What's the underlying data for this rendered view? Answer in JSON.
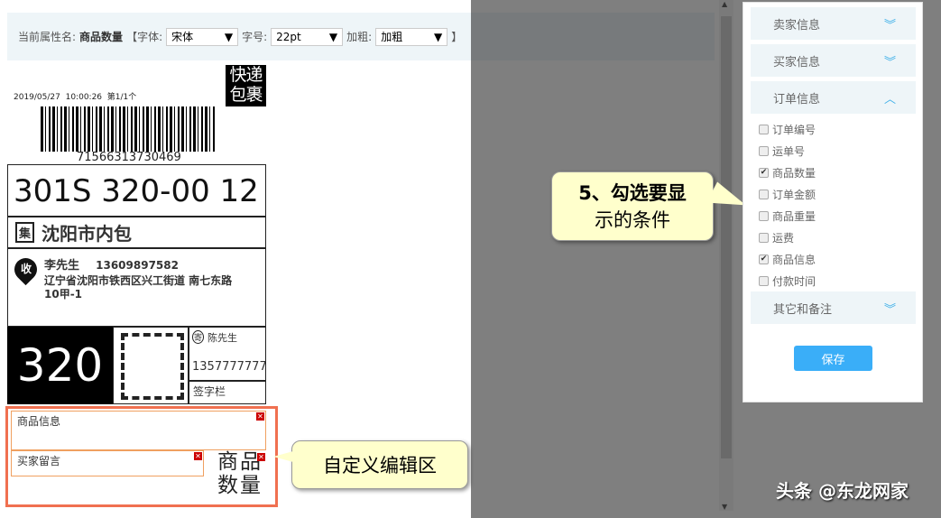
{
  "toolbar": {
    "prefix": "当前属性名:",
    "attr_name": "商品数量",
    "font_label": "【字体:",
    "font_value": "宋体",
    "size_label": "字号:",
    "size_value": "22pt",
    "bold_label": "加粗:",
    "bold_value": "加粗",
    "suffix": "】"
  },
  "label": {
    "date": "2019/05/27",
    "time": "10:00:26",
    "count": "第1/1个",
    "badge": "快递包裹",
    "barcode_number": "71566313730469",
    "route_code": "301S 320-00 12",
    "collect_icon": "集",
    "collect_city": "沈阳市内包",
    "receiver_icon": "收",
    "receiver_name": "李先生",
    "receiver_phone": "13609897582",
    "receiver_address": "辽宁省沈阳市铁西区兴工街道 南七东路10甲-1",
    "big_code": "320",
    "sender_icon": "寄",
    "sender_name": "陈先生",
    "sender_phone": "1357777777",
    "signature": "签字栏"
  },
  "custom": {
    "goods_info": "商品信息",
    "buyer_note": "买家留言",
    "goods_qty": "商品数量"
  },
  "callouts": {
    "custom_area": "自定义编辑区",
    "step5_line1": "5、勾选要显",
    "step5_line2": "示的条件"
  },
  "panel": {
    "sections": [
      {
        "label": "卖家信息"
      },
      {
        "label": "买家信息"
      },
      {
        "label": "订单信息"
      },
      {
        "label": "其它和备注"
      }
    ],
    "options": [
      {
        "label": "订单编号",
        "checked": false
      },
      {
        "label": "运单号",
        "checked": false
      },
      {
        "label": "商品数量",
        "checked": true
      },
      {
        "label": "订单金额",
        "checked": false
      },
      {
        "label": "商品重量",
        "checked": false
      },
      {
        "label": "运费",
        "checked": false
      },
      {
        "label": "商品信息",
        "checked": true
      },
      {
        "label": "付款时间",
        "checked": false
      }
    ],
    "save": "保存"
  },
  "watermark": "头条 @东龙网家"
}
